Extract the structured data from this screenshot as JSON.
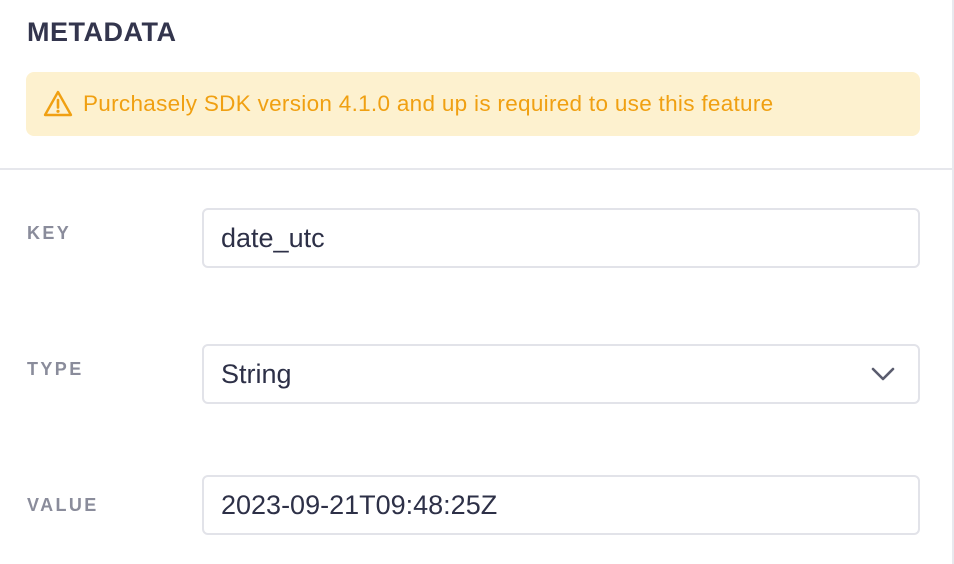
{
  "section": {
    "title": "METADATA"
  },
  "warning": {
    "icon": "warning-triangle-icon",
    "text": "Purchasely SDK version 4.1.0 and up is required to use this feature",
    "color": "#f0a012",
    "background": "#fdf1cf"
  },
  "fields": {
    "key": {
      "label": "KEY",
      "value": "date_utc"
    },
    "type": {
      "label": "TYPE",
      "value": "String",
      "icon": "chevron-down-icon"
    },
    "value": {
      "label": "VALUE",
      "value": "2023-09-21T09:48:25Z"
    }
  }
}
